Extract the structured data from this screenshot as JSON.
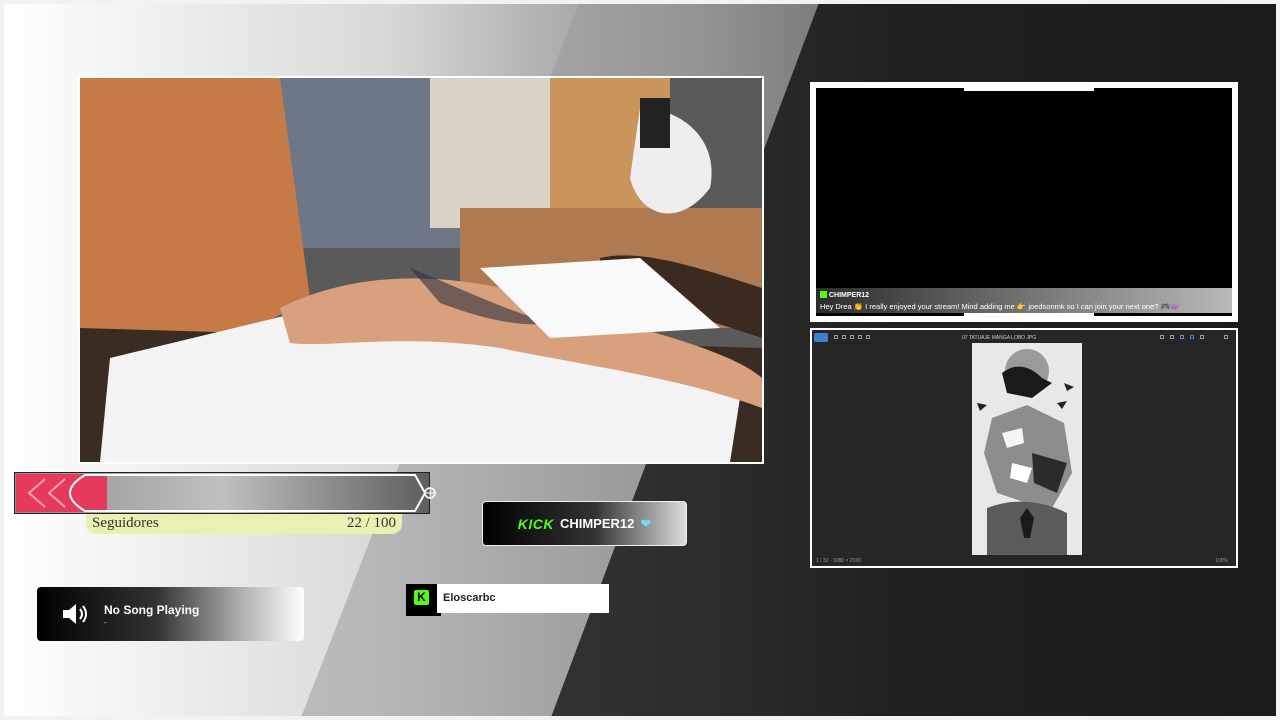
{
  "colors": {
    "kick_green": "#53fc18",
    "goal_fill": "#e63a5c",
    "goal_label_bg": "#e9f0b2",
    "heart": "#6ee0f5"
  },
  "camera": {
    "icon": "tattoo-camera-feed"
  },
  "goal": {
    "label": "Seguidores",
    "count": "22 / 100",
    "current": 22,
    "target": 100,
    "progress": 0.22
  },
  "kick_badge": {
    "logo": "KICK",
    "channel": "CHIMPER12",
    "icon": "heart-icon"
  },
  "music": {
    "title": "No Song Playing",
    "subtitle": "-",
    "icon": "speaker-icon"
  },
  "follower": {
    "logo": "K",
    "name": "Eloscarbc"
  },
  "chat": {
    "username": "CHIMPER12",
    "message": "Hey Drea 👏 I really enjoyed your stream! Mind adding me 👉 joedsonmk so I can join your next one? 🎮👾"
  },
  "viewer": {
    "filename": "07 TATUAJE MANGA LOBO JPG",
    "status_left": "1 / 32 · 1080 × 2160",
    "status_right": "100%"
  }
}
